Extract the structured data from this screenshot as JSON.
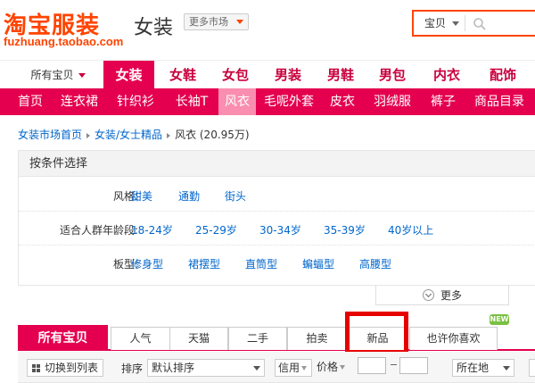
{
  "header": {
    "logo": "淘宝服装",
    "logo_url_text": "fuzhuang.taobao.com",
    "category": "女装",
    "more_market": "更多市场",
    "search_scope": "宝贝",
    "search_placeholder": ""
  },
  "nav_top": {
    "all_label": "所有宝贝",
    "items": [
      "女装",
      "女鞋",
      "女包",
      "男装",
      "男鞋",
      "男包",
      "内衣",
      "配饰"
    ],
    "active": "女装"
  },
  "nav_sub": {
    "items": [
      "首页",
      "连衣裙",
      "针织衫",
      "长袖T",
      "风衣",
      "毛呢外套",
      "皮衣",
      "羽绒服",
      "裤子",
      "商品目录"
    ],
    "active": "风衣"
  },
  "breadcrumb": {
    "home": "女装市场首页",
    "level2": "女装/女士精品",
    "current": "风衣 (20.95万)"
  },
  "filter": {
    "title": "按条件选择",
    "style_label": "风格:",
    "style_options": [
      "甜美",
      "通勤",
      "街头"
    ],
    "age_label": "适合人群年龄段:",
    "age_options": [
      "18-24岁",
      "25-29岁",
      "30-34岁",
      "35-39岁",
      "40岁以上"
    ],
    "shape_label": "板型:",
    "shape_options": [
      "修身型",
      "裙摆型",
      "直筒型",
      "蝙蝠型",
      "高腰型"
    ],
    "more": "更多"
  },
  "tabs": {
    "items": [
      "所有宝贝",
      "人气",
      "天猫",
      "二手",
      "拍卖",
      "新品",
      "也许你喜欢"
    ],
    "active": "所有宝贝",
    "new_badge": "NEW",
    "highlighted": "新品"
  },
  "toolbar": {
    "list_toggle": "切换到列表",
    "sort_label": "排序",
    "sort_value": "默认排序",
    "credit": "信用",
    "price": "价格",
    "location": "所在地"
  },
  "colors": {
    "brand": "#ff4400",
    "nav_active": "#e4004f",
    "highlight_box": "#e60000",
    "new_badge": "#7ac142"
  }
}
